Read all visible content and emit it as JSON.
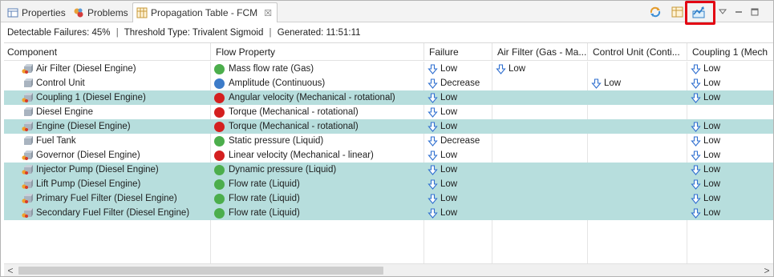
{
  "tabs": [
    {
      "label": "Properties",
      "icon": "properties-icon",
      "active": false
    },
    {
      "label": "Problems",
      "icon": "problems-icon",
      "active": false
    },
    {
      "label": "Propagation Table - FCM",
      "icon": "table-icon",
      "active": true,
      "close": "☒"
    }
  ],
  "status": {
    "detectable": "Detectable Failures: 45%",
    "threshold": "Threshold Type: Trivalent Sigmoid",
    "generated": "Generated: 11:51:11",
    "separator": "|"
  },
  "columns": [
    "Component",
    "Flow Property",
    "Failure",
    "Air Filter (Gas - Ma...",
    "Control Unit (Conti...",
    "Coupling 1 (Mech"
  ],
  "rows": [
    {
      "component": "Air Filter (Diesel Engine)",
      "comp_icon": "component-warning-icon",
      "dot": "#4cae4c",
      "flow": "Mass flow rate (Gas)",
      "failure": "Low",
      "air": "Low",
      "control": "",
      "coupling": "Low",
      "highlight": false
    },
    {
      "component": "Control Unit",
      "comp_icon": "component-icon",
      "dot": "#3d7cc9",
      "flow": "Amplitude (Continuous)",
      "failure": "Decrease",
      "air": "",
      "control": "Low",
      "coupling": "Low",
      "highlight": false
    },
    {
      "component": "Coupling 1 (Diesel Engine)",
      "comp_icon": "component-warning-icon",
      "dot": "#d42020",
      "flow": "Angular velocity (Mechanical - rotational)",
      "failure": "Low",
      "air": "",
      "control": "",
      "coupling": "Low",
      "highlight": true
    },
    {
      "component": "Diesel Engine",
      "comp_icon": "component-icon",
      "dot": "#d42020",
      "flow": "Torque (Mechanical - rotational)",
      "failure": "Low",
      "air": "",
      "control": "",
      "coupling": "",
      "highlight": false
    },
    {
      "component": "Engine (Diesel Engine)",
      "comp_icon": "component-warning-icon",
      "dot": "#d42020",
      "flow": "Torque (Mechanical - rotational)",
      "failure": "Low",
      "air": "",
      "control": "",
      "coupling": "Low",
      "highlight": true
    },
    {
      "component": "Fuel Tank",
      "comp_icon": "component-icon",
      "dot": "#4cae4c",
      "flow": "Static pressure (Liquid)",
      "failure": "Decrease",
      "air": "",
      "control": "",
      "coupling": "Low",
      "highlight": false
    },
    {
      "component": "Governor (Diesel Engine)",
      "comp_icon": "component-warning-icon",
      "dot": "#d42020",
      "flow": "Linear velocity (Mechanical - linear)",
      "failure": "Low",
      "air": "",
      "control": "",
      "coupling": "Low",
      "highlight": false
    },
    {
      "component": "Injector Pump (Diesel Engine)",
      "comp_icon": "component-warning-icon",
      "dot": "#4cae4c",
      "flow": "Dynamic pressure (Liquid)",
      "failure": "Low",
      "air": "",
      "control": "",
      "coupling": "Low",
      "highlight": true
    },
    {
      "component": "Lift Pump (Diesel Engine)",
      "comp_icon": "component-warning-icon",
      "dot": "#4cae4c",
      "flow": "Flow rate (Liquid)",
      "failure": "Low",
      "air": "",
      "control": "",
      "coupling": "Low",
      "highlight": true
    },
    {
      "component": "Primary Fuel Filter (Diesel Engine)",
      "comp_icon": "component-warning-icon",
      "dot": "#4cae4c",
      "flow": "Flow rate (Liquid)",
      "failure": "Low",
      "air": "",
      "control": "",
      "coupling": "Low",
      "highlight": true
    },
    {
      "component": "Secondary Fuel Filter (Diesel Engine)",
      "comp_icon": "component-warning-icon",
      "dot": "#4cae4c",
      "flow": "Flow rate (Liquid)",
      "failure": "Low",
      "air": "",
      "control": "",
      "coupling": "Low",
      "highlight": true
    }
  ],
  "toolbar": {
    "icons": [
      "sync-icon",
      "table-view-icon",
      "export-chart-icon",
      "view-menu-icon",
      "minimize-icon",
      "maximize-icon"
    ],
    "highlight_color": "#e30613"
  },
  "scrollbar": {
    "left": "<",
    "right": ">"
  },
  "colors": {
    "highlight_row": "#b7dedd",
    "arrow": "#2f6fd0"
  }
}
